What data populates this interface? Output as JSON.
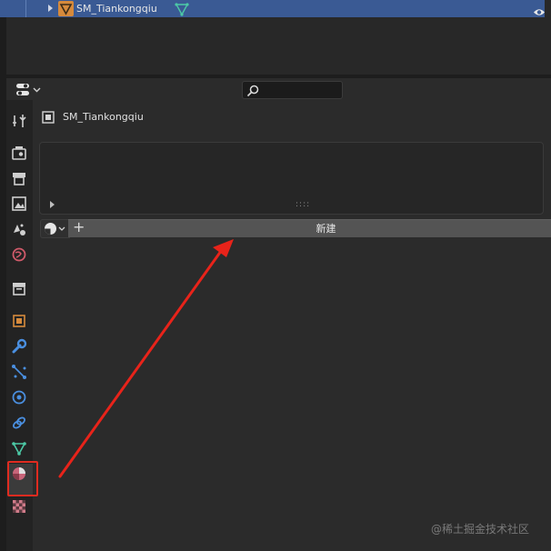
{
  "outliner": {
    "object_name": "SM_Tiankongqiu"
  },
  "properties": {
    "object_name": "SM_Tiankongqiu",
    "new_button_label": "新建",
    "new_plus": "+",
    "grip": "::::"
  },
  "tabs": [
    {
      "name": "tool-tab-icon"
    },
    {
      "name": "render-tab-icon"
    },
    {
      "name": "output-tab-icon"
    },
    {
      "name": "view-layer-tab-icon"
    },
    {
      "name": "scene-tab-icon"
    },
    {
      "name": "world-tab-icon"
    },
    {
      "name": "collection-tab-icon"
    },
    {
      "name": "object-tab-icon"
    },
    {
      "name": "modifier-tab-icon"
    },
    {
      "name": "particles-tab-icon"
    },
    {
      "name": "physics-tab-icon"
    },
    {
      "name": "constraints-tab-icon"
    },
    {
      "name": "data-tab-icon"
    },
    {
      "name": "material-tab-icon"
    },
    {
      "name": "texture-tab-icon"
    }
  ],
  "watermark": "@稀土掘金技术社区",
  "colors": {
    "selection": "#3a5a94",
    "annotation_red": "#e02b20"
  }
}
